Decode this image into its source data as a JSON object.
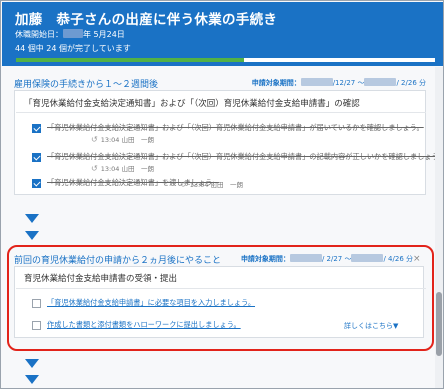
{
  "header": {
    "title": "加藤　恭子さんの出産に伴う休業の手続き",
    "start_prefix": "休職開始日：",
    "start_suffix": "年 5月24日",
    "done_text": "44 個中 24 個が完了しています",
    "progress_fraction": 0.545
  },
  "section1": {
    "title": "雇用保険の手続きから１～２週間後",
    "period_label": "申請対象期間：",
    "period_mid": "/12/27 ～",
    "period_end": "/ 2/26 分",
    "card_title": "「育児休業給付金支給決定通知書」および「（次回）育児休業給付金支給申請書」の確認",
    "tasks": [
      {
        "text": "「育児休業給付金支給決定通知書」および「（次回）育児休業給付金支給申請書」が届いているかを確認しましょう。",
        "time": "13:04",
        "user": "山田　一朗",
        "checked": true
      },
      {
        "text": "「育児休業給付金支給決定通知書」および「（次回）育児休業給付金支給申請書」の記載内容が正しいかを確認しましょう。",
        "time": "13:04",
        "user": "山田　一朗",
        "checked": true
      },
      {
        "text": "「育児休業給付金支給決定通知書」を渡しましょう。",
        "time": "13:04",
        "user": "山田　一朗",
        "checked": true
      }
    ]
  },
  "section2": {
    "title": "前回の育児休業給付の申請から２ヵ月後にやること",
    "period_label": "申請対象期間：",
    "period_mid": "/ 2/27 ～",
    "period_end": "/ 4/26 分",
    "close": "×",
    "card_title": "育児休業給付金支給申請書の受領・提出",
    "tasks": [
      {
        "text": "「育児休業給付金支給申請書」に必要な項目を入力しましょう。",
        "checked": false
      },
      {
        "text": "作成した書類と添付書類をハローワークに提出しましょう。",
        "checked": false
      }
    ],
    "details_link": "詳しくはこちら▼"
  },
  "icons": {
    "undo": "↺",
    "arrow": "down-triangle",
    "accent": "#1a72c5",
    "highlight": "#e2231a",
    "progress": "#52b146"
  }
}
